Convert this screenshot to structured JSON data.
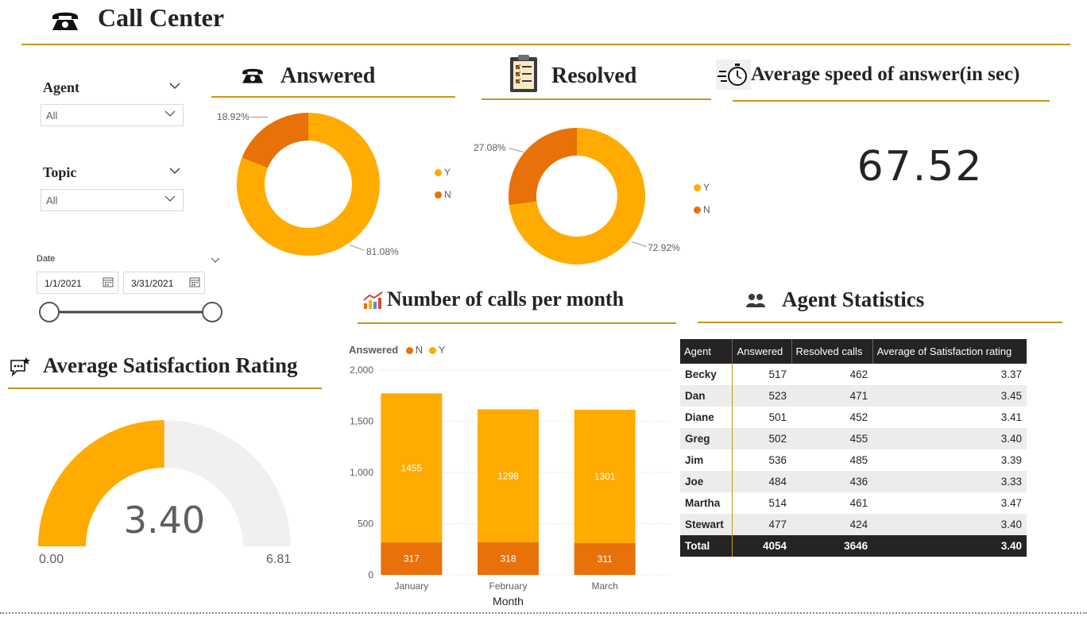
{
  "header": {
    "title": "Call Center",
    "icon": "telephone-icon"
  },
  "filters": {
    "agent": {
      "label": "Agent",
      "value": "All"
    },
    "topic": {
      "label": "Topic",
      "value": "All"
    },
    "date": {
      "label": "Date",
      "start": "1/1/2021",
      "end": "3/31/2021"
    }
  },
  "answered": {
    "title": "Answered",
    "icon": "telephone-icon",
    "legend": [
      "Y",
      "N"
    ],
    "slices": [
      {
        "name": "Y",
        "label": "81.08%",
        "value": 81.08,
        "color": "#ffab00"
      },
      {
        "name": "N",
        "label": "18.92%",
        "value": 18.92,
        "color": "#e8710a"
      }
    ]
  },
  "resolved": {
    "title": "Resolved",
    "icon": "clipboard-checklist-icon",
    "legend": [
      "Y",
      "N"
    ],
    "slices": [
      {
        "name": "Y",
        "label": "72.92%",
        "value": 72.92,
        "color": "#ffab00"
      },
      {
        "name": "N",
        "label": "27.08%",
        "value": 27.08,
        "color": "#e8710a"
      }
    ]
  },
  "speed": {
    "title": "Average speed of answer(in sec)",
    "value": "67.52",
    "icon": "stopwatch-icon"
  },
  "satisfaction": {
    "title": "Average Satisfaction Rating",
    "icon": "chat-rating-icon",
    "value": "3.40",
    "min": "0.00",
    "max": "6.81",
    "level": 3.4,
    "range_max": 6.81
  },
  "calls": {
    "title": "Number of calls per month",
    "icon": "line-chart-icon"
  },
  "chart_data": {
    "type": "bar",
    "stacked": true,
    "title": "Number of calls per month",
    "xlabel": "Month",
    "ylabel": "",
    "legend_title": "Answered",
    "legend": [
      "N",
      "Y"
    ],
    "categories": [
      "January",
      "February",
      "March"
    ],
    "series": [
      {
        "name": "N",
        "values": [
          317,
          318,
          311
        ],
        "color": "#e8710a"
      },
      {
        "name": "Y",
        "values": [
          1455,
          1298,
          1301
        ],
        "color": "#ffab00"
      }
    ],
    "ylim": [
      0,
      2000
    ],
    "yticks": [
      "0",
      "500",
      "1,000",
      "1,500",
      "2,000"
    ],
    "ytick_values": [
      0,
      500,
      1000,
      1500,
      2000
    ],
    "grid": true
  },
  "agents": {
    "title": "Agent Statistics",
    "icon": "people-icon",
    "columns": [
      "Agent",
      "Answered",
      "Resolved calls",
      "Average of Satisfaction rating"
    ],
    "rows": [
      [
        "Becky",
        "517",
        "462",
        "3.37"
      ],
      [
        "Dan",
        "523",
        "471",
        "3.45"
      ],
      [
        "Diane",
        "501",
        "452",
        "3.41"
      ],
      [
        "Greg",
        "502",
        "455",
        "3.40"
      ],
      [
        "Jim",
        "536",
        "485",
        "3.39"
      ],
      [
        "Joe",
        "484",
        "436",
        "3.33"
      ],
      [
        "Martha",
        "514",
        "461",
        "3.47"
      ],
      [
        "Stewart",
        "477",
        "424",
        "3.40"
      ]
    ],
    "total": [
      "Total",
      "4054",
      "3646",
      "3.40"
    ]
  }
}
